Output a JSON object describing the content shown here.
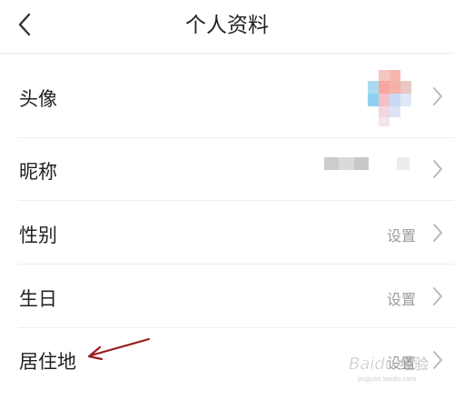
{
  "header": {
    "title": "个人资料",
    "back_icon": "chevron-left-icon"
  },
  "rows": [
    {
      "label": "头像",
      "value": "",
      "kind": "avatar"
    },
    {
      "label": "昵称",
      "value": "",
      "kind": "nickname"
    },
    {
      "label": "性别",
      "value": "设置"
    },
    {
      "label": "生日",
      "value": "设置"
    },
    {
      "label": "居住地",
      "value": "设置"
    }
  ],
  "watermark": {
    "text": "Baidu 经验"
  },
  "colors": {
    "text": "#222222",
    "secondary": "#9b9b9b",
    "divider": "#eeeeee",
    "annotation_arrow": "#9a1d1d"
  }
}
